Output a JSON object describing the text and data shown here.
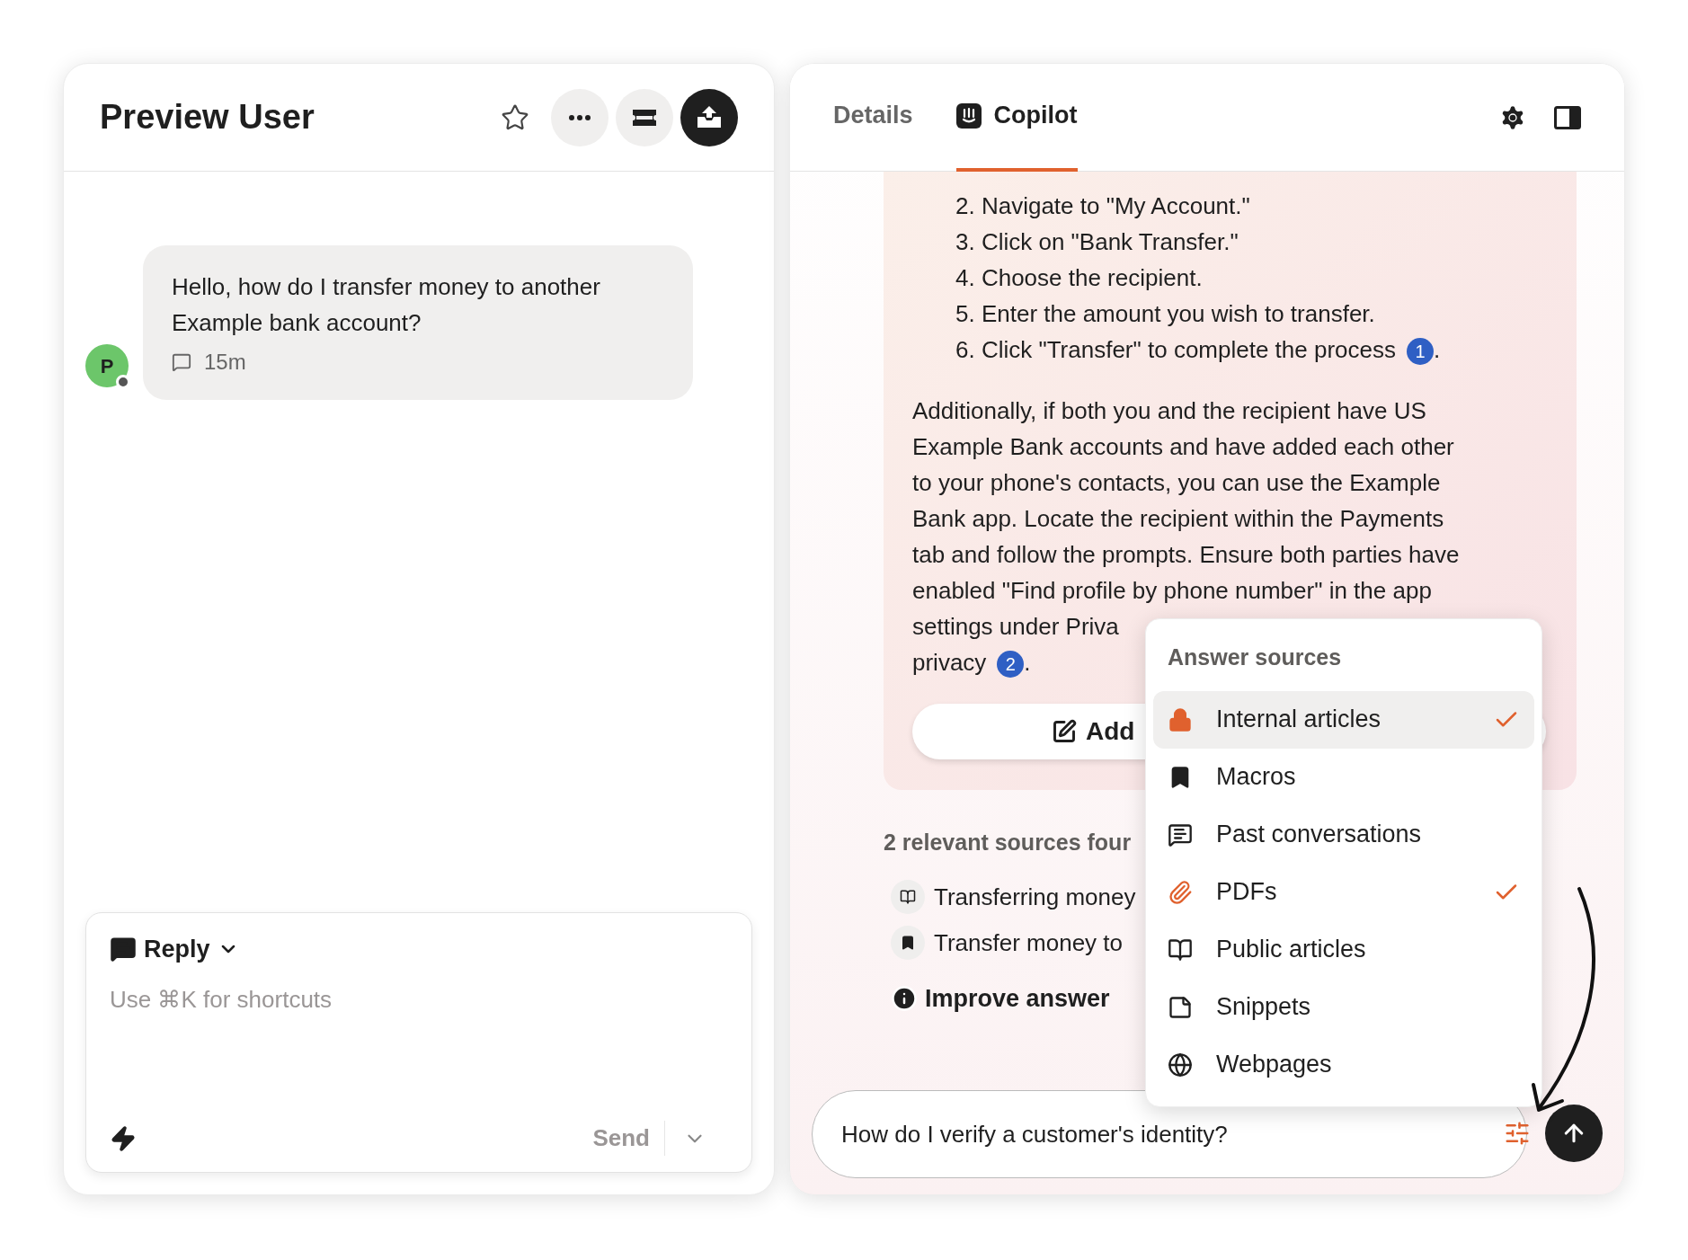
{
  "conversation": {
    "title": "Preview User",
    "starred": false,
    "message": {
      "text": "Hello, how do I transfer money to another Example bank account?",
      "avatar": "P",
      "time": "15m"
    },
    "composer": {
      "mode": "Reply",
      "placeholder": "Use ⌘K for shortcuts",
      "send": {
        "label": "Send",
        "disabled": true
      }
    }
  },
  "copilot": {
    "tabs": [
      {
        "label": "Details",
        "selected": false
      },
      {
        "label": "Copilot",
        "selected": true
      }
    ],
    "steps": [
      "2. Navigate to \"My Account.\"",
      "3. Click on \"Bank Transfer.\"",
      "4. Choose the recipient.",
      "5. Enter the amount you wish to transfer.",
      "6. Click \"Transfer\" to complete the process"
    ],
    "step_citation": "1",
    "step_period": ".",
    "paragraph_lines": [
      "Additionally, if both you and the recipient have US",
      "Example Bank accounts and have added each other",
      "to your phone's contacts, you can use the Example",
      "Bank app. Locate the recipient within the Payments",
      "tab and follow the prompts. Ensure both parties have",
      "enabled \"Find profile by phone number\" in the app",
      "settings under Priva"
    ],
    "paragraph_end": "privacy",
    "paragraph_citation": "2",
    "paragraph_period": ".",
    "add_button": "Add",
    "sources_heading": "2 relevant sources four",
    "sources": [
      {
        "kind": "book",
        "title": "Transferring money"
      },
      {
        "kind": "bookmark",
        "title": "Transfer money to"
      }
    ],
    "improve": "Improve answer",
    "input": {
      "value": "How do I verify a customer's identity?"
    },
    "menu": {
      "title": "Answer sources",
      "items": [
        {
          "kind": "lock",
          "label": "Internal articles",
          "checked": true,
          "highlighted": true
        },
        {
          "kind": "bookmark",
          "label": "Macros",
          "checked": false,
          "highlighted": false
        },
        {
          "kind": "chat",
          "label": "Past conversations",
          "checked": false,
          "highlighted": false
        },
        {
          "kind": "clip",
          "label": "PDFs",
          "checked": true,
          "highlighted": false
        },
        {
          "kind": "book",
          "label": "Public articles",
          "checked": false,
          "highlighted": false
        },
        {
          "kind": "note",
          "label": "Snippets",
          "checked": false,
          "highlighted": false
        },
        {
          "kind": "globe",
          "label": "Webpages",
          "checked": false,
          "highlighted": false
        }
      ]
    }
  }
}
